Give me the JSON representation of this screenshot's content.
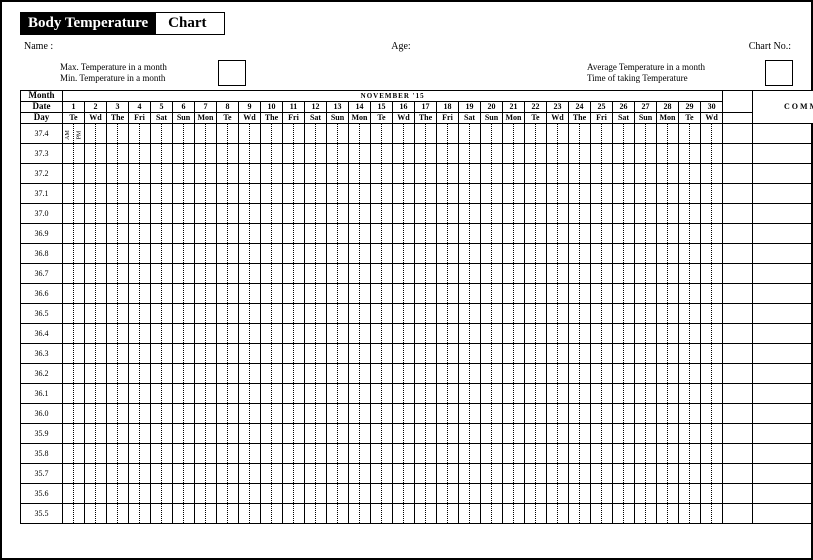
{
  "title": {
    "left": "Body Temperature",
    "right": "Chart"
  },
  "info": {
    "name_label": "Name :",
    "age_label": "Age:",
    "chart_no_label": "Chart No.:"
  },
  "summary": {
    "max_label": "Max. Temperature in a month",
    "min_label": "Min. Temperature in a month",
    "avg_label": "Average Temperature in a month",
    "time_label": "Time of taking Temperature"
  },
  "grid": {
    "stub_month": "Month",
    "stub_date": "Date",
    "stub_day": "Day",
    "month_heading": "NOVEMBER '15",
    "comment_heading": "COMMENT",
    "am_label": "AM",
    "pm_label": "PM",
    "dates": [
      1,
      2,
      3,
      4,
      5,
      6,
      7,
      8,
      9,
      10,
      11,
      12,
      13,
      14,
      15,
      16,
      17,
      18,
      19,
      20,
      21,
      22,
      23,
      24,
      25,
      26,
      27,
      28,
      29,
      30
    ],
    "days": [
      "Te",
      "Wd",
      "The",
      "Fri",
      "Sat",
      "Sun",
      "Mon",
      "Te",
      "Wd",
      "The",
      "Fri",
      "Sat",
      "Sun",
      "Mon",
      "Te",
      "Wd",
      "The",
      "Fri",
      "Sat",
      "Sun",
      "Mon",
      "Te",
      "Wd",
      "The",
      "Fri",
      "Sat",
      "Sun",
      "Mon",
      "Te",
      "Wd"
    ],
    "temps": [
      37.4,
      37.3,
      37.2,
      37.1,
      37.0,
      36.9,
      36.8,
      36.7,
      36.6,
      36.5,
      36.4,
      36.3,
      36.2,
      36.1,
      36.0,
      35.9,
      35.8,
      35.7,
      35.6,
      35.5
    ]
  },
  "chart_data": {
    "type": "table",
    "title": "Body Temperature Chart",
    "xlabel": "Date (Nov '15)",
    "ylabel": "Temperature",
    "categories": [
      1,
      2,
      3,
      4,
      5,
      6,
      7,
      8,
      9,
      10,
      11,
      12,
      13,
      14,
      15,
      16,
      17,
      18,
      19,
      20,
      21,
      22,
      23,
      24,
      25,
      26,
      27,
      28,
      29,
      30
    ],
    "y_ticks": [
      37.4,
      37.3,
      37.2,
      37.1,
      37.0,
      36.9,
      36.8,
      36.7,
      36.6,
      36.5,
      36.4,
      36.3,
      36.2,
      36.1,
      36.0,
      35.9,
      35.8,
      35.7,
      35.6,
      35.5
    ],
    "series": []
  }
}
